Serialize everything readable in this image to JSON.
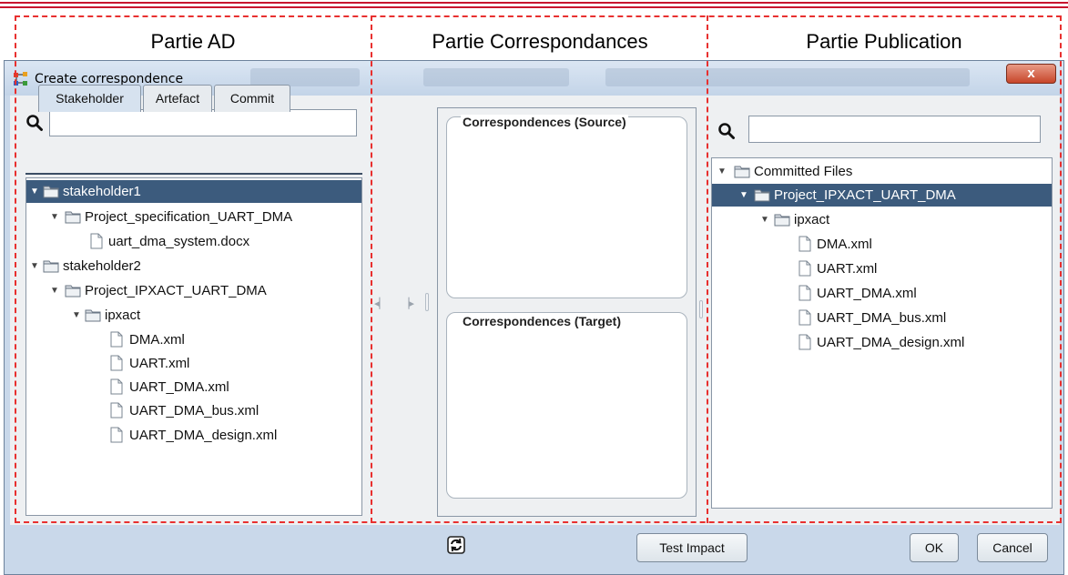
{
  "parts": {
    "ad": "Partie AD",
    "corr": "Partie Correspondances",
    "pub": "Partie Publication"
  },
  "window": {
    "title": "Create correspondence",
    "close_label": "x"
  },
  "left": {
    "search_value": "",
    "tabs": [
      "Stakeholder",
      "Artefact",
      "Commit"
    ],
    "tree": [
      {
        "label": "stakeholder1",
        "type": "folder",
        "expanded": true,
        "selected": true
      },
      {
        "label": "Project_specification_UART_DMA",
        "type": "folder",
        "expanded": true
      },
      {
        "label": "uart_dma_system.docx",
        "type": "file"
      },
      {
        "label": "stakeholder2",
        "type": "folder",
        "expanded": true
      },
      {
        "label": "Project_IPXACT_UART_DMA",
        "type": "folder",
        "expanded": true
      },
      {
        "label": "ipxact",
        "type": "folder",
        "expanded": true
      },
      {
        "label": "DMA.xml",
        "type": "file"
      },
      {
        "label": "UART.xml",
        "type": "file"
      },
      {
        "label": "UART_DMA.xml",
        "type": "file"
      },
      {
        "label": "UART_DMA_bus.xml",
        "type": "file"
      },
      {
        "label": "UART_DMA_design.xml",
        "type": "file"
      }
    ]
  },
  "middle": {
    "source_title": "Correspondences (Source)",
    "target_title": "Correspondences (Target)"
  },
  "right": {
    "search_value": "",
    "tree": [
      {
        "label": "Committed Files",
        "type": "folder",
        "expanded": true
      },
      {
        "label": "Project_IPXACT_UART_DMA",
        "type": "folder",
        "expanded": true,
        "selected": true
      },
      {
        "label": "ipxact",
        "type": "folder",
        "expanded": true
      },
      {
        "label": "DMA.xml",
        "type": "file"
      },
      {
        "label": "UART.xml",
        "type": "file"
      },
      {
        "label": "UART_DMA.xml",
        "type": "file"
      },
      {
        "label": "UART_DMA_bus.xml",
        "type": "file"
      },
      {
        "label": "UART_DMA_design.xml",
        "type": "file"
      }
    ]
  },
  "footer": {
    "test_impact": "Test Impact",
    "ok": "OK",
    "cancel": "Cancel"
  },
  "colors": {
    "accent_red": "#e8302f",
    "selection": "#3c5b7d"
  }
}
